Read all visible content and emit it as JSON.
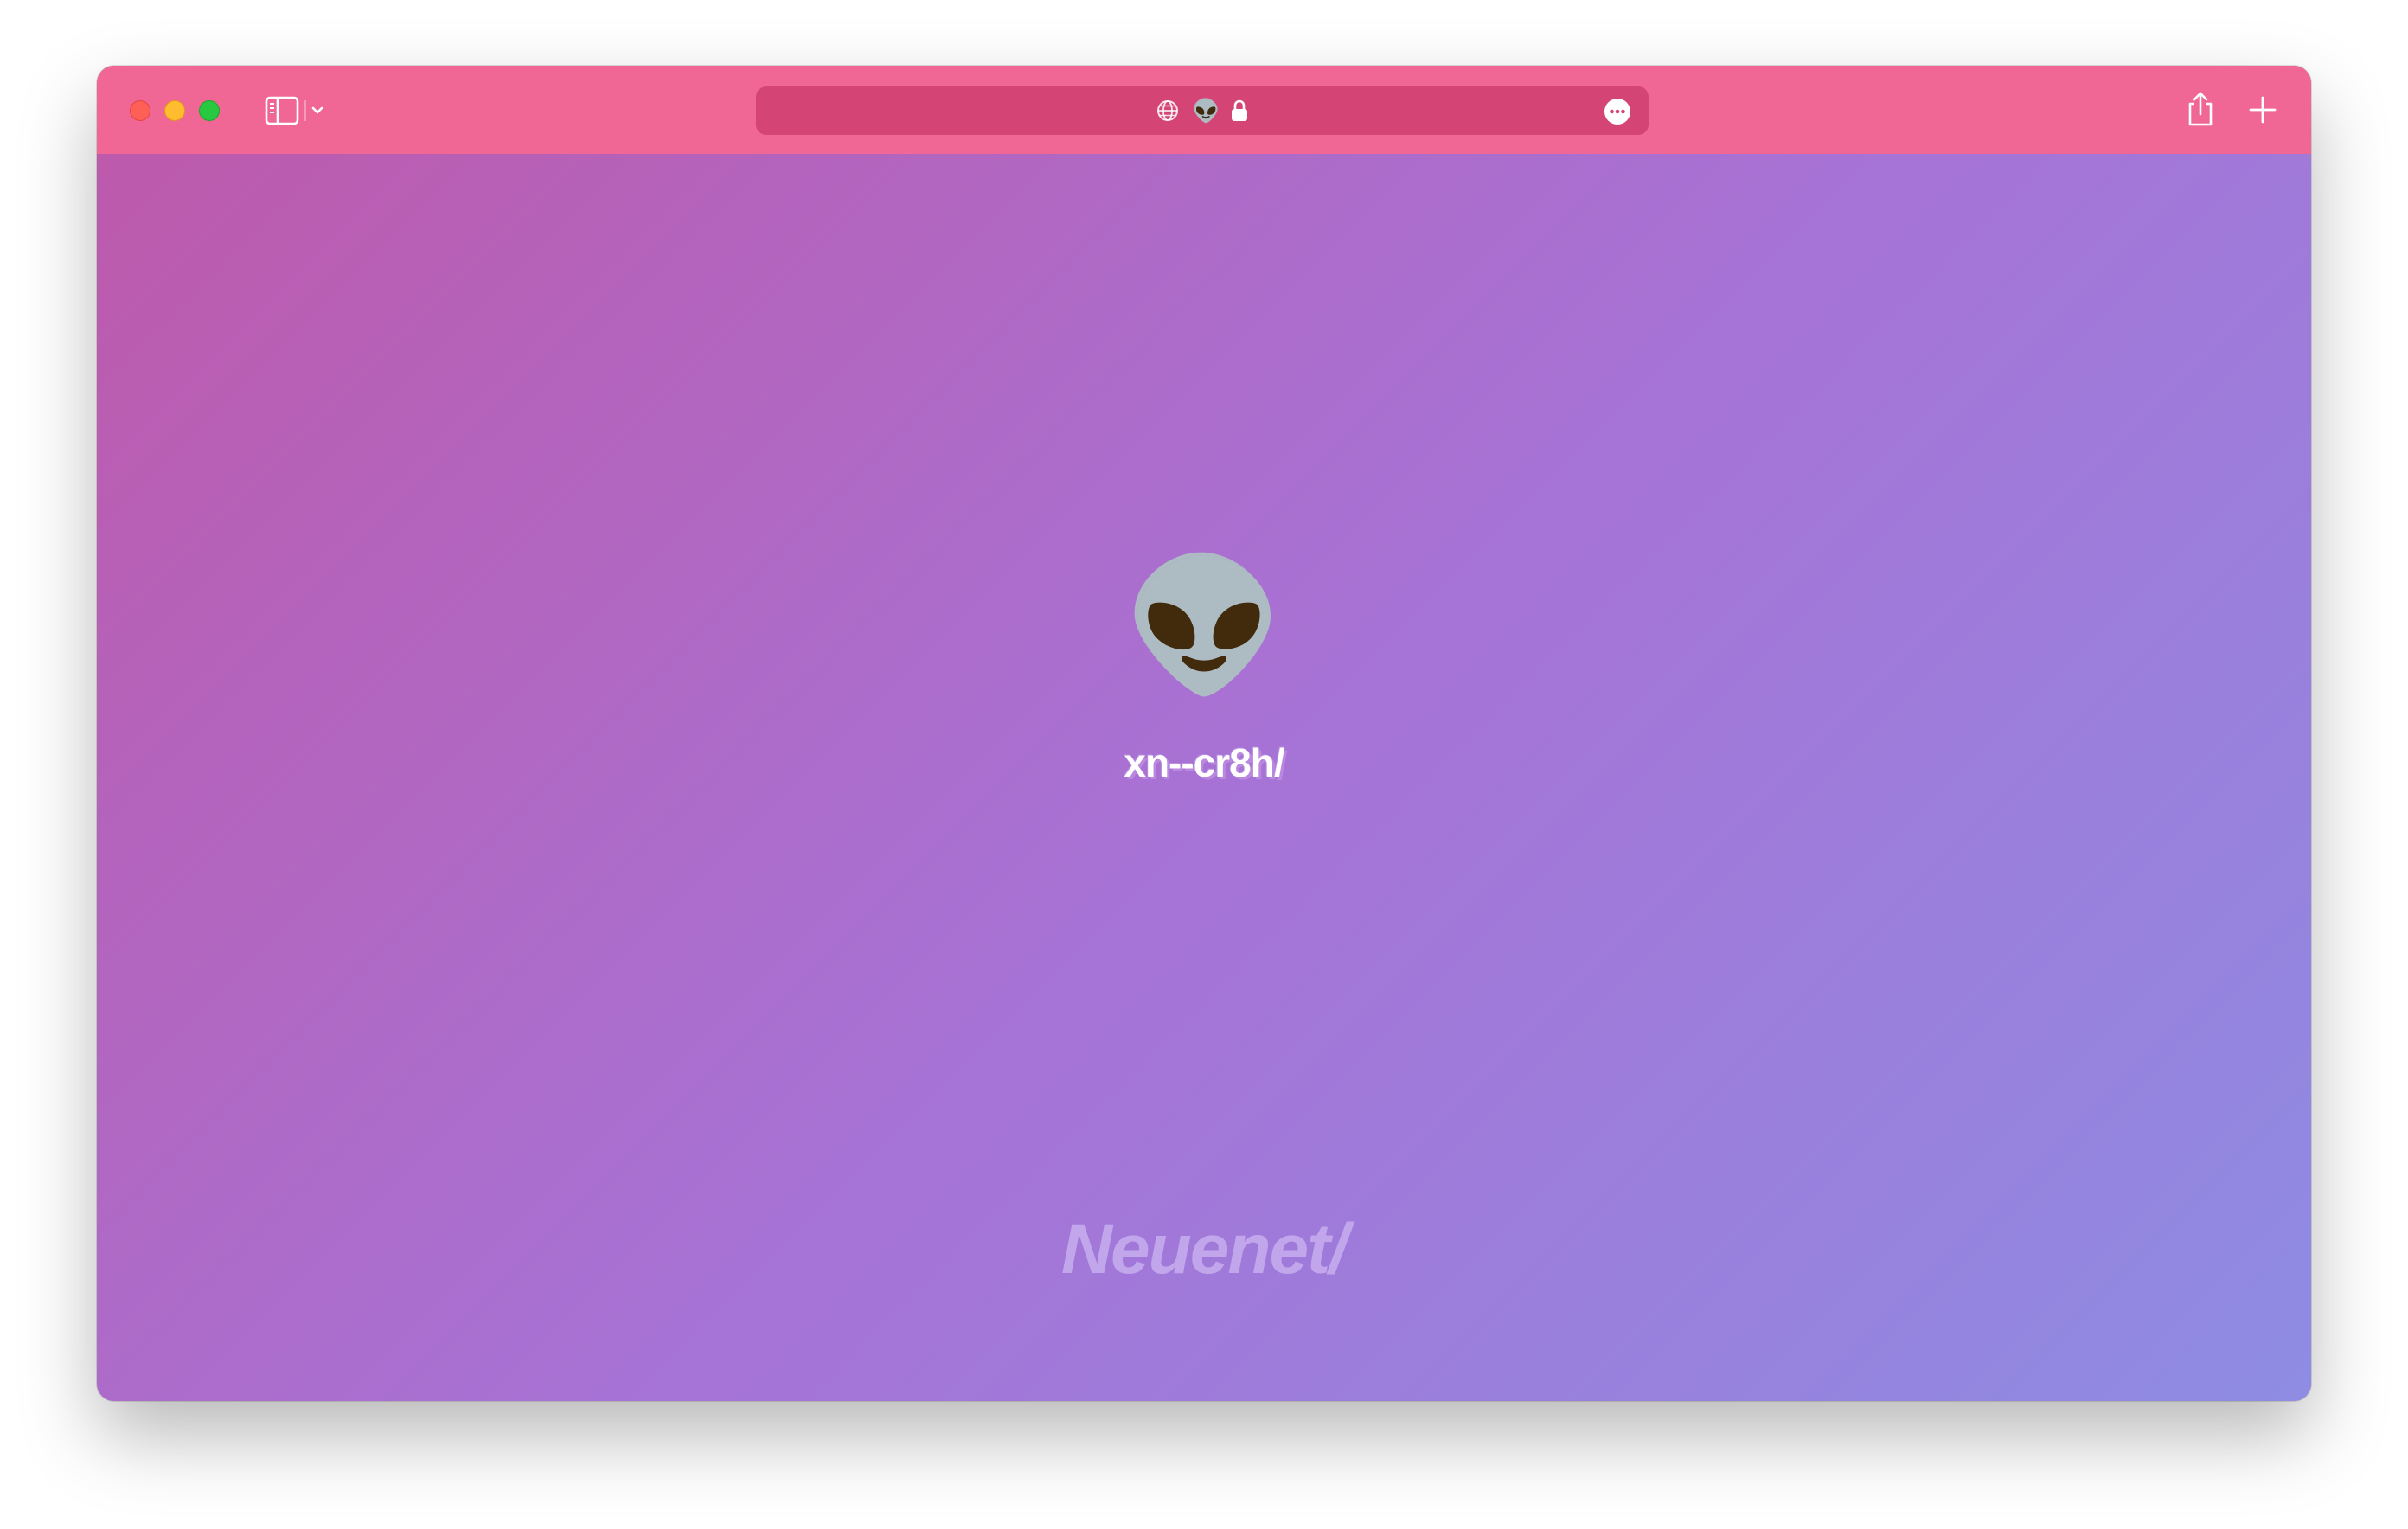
{
  "browser": {
    "address_bar": {
      "favicon": "👽",
      "icons": [
        "globe-icon",
        "lock-icon",
        "more-options-icon"
      ]
    },
    "toolbar_icons": [
      "sidebar-icon",
      "chevron-down-icon",
      "share-icon",
      "plus-icon"
    ]
  },
  "page": {
    "emoji": "👽",
    "domain_label": "xn--cr8h/",
    "brand": "Neuenet/"
  },
  "colors": {
    "toolbar": "#f06795",
    "address_bar": "#d44576",
    "gradient_start": "#bd5aac",
    "gradient_mid": "#a673d6",
    "gradient_end": "#8e8ce3",
    "brand_text": "#c1a6ec"
  }
}
